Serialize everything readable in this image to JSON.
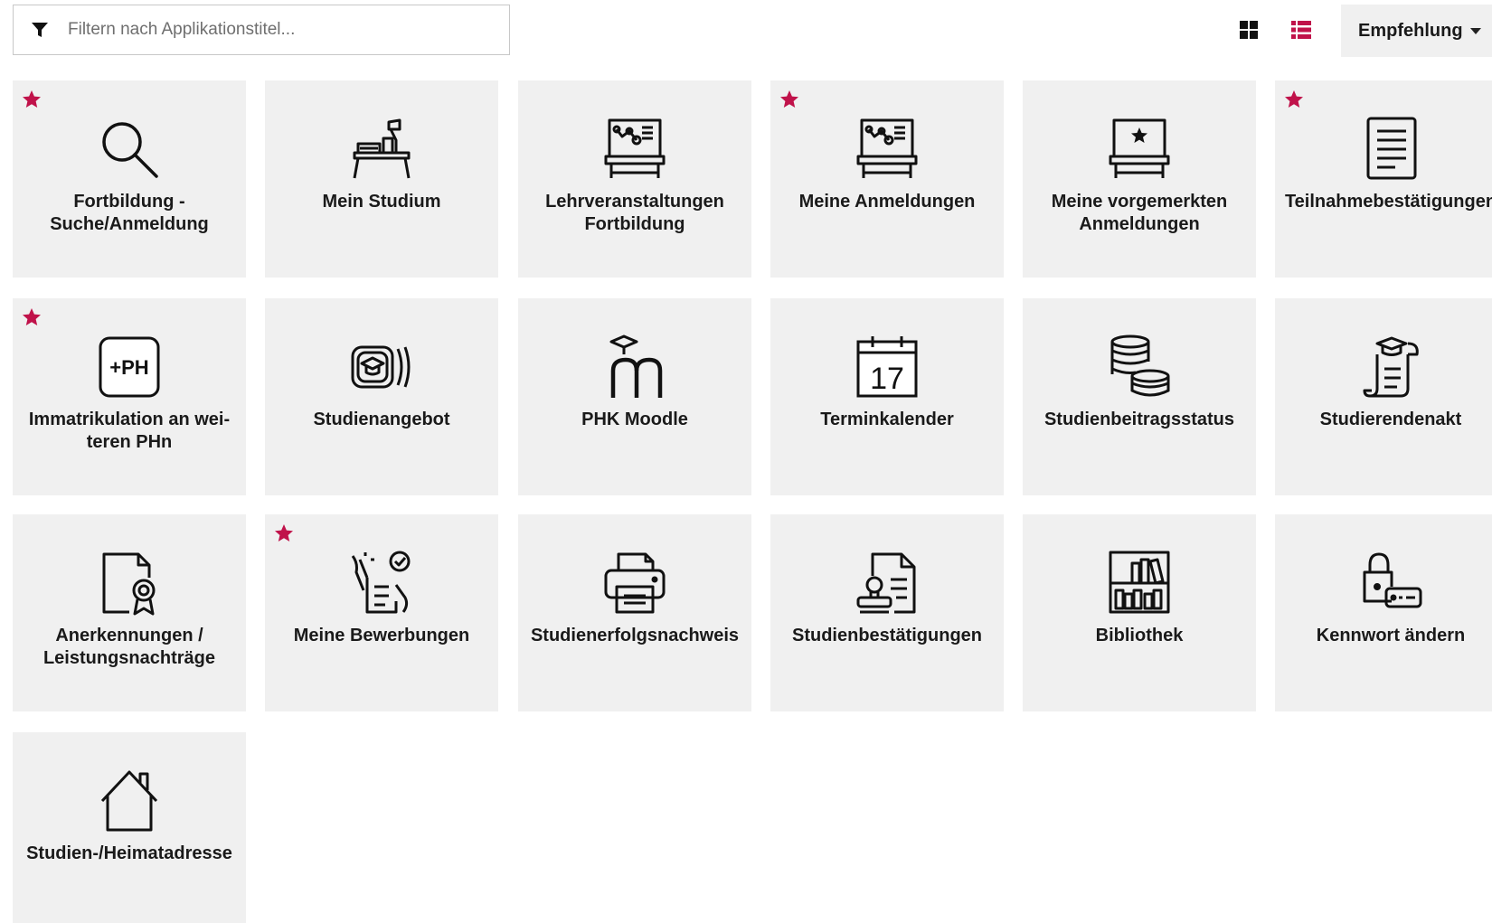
{
  "toolbar": {
    "filter_placeholder": "Filtern nach Applikationstitel...",
    "filter_value": "",
    "sort_label": "Empfehlung",
    "accent_color": "#c0124a"
  },
  "tiles": [
    {
      "label": "Fortbildung - Suche/Anmeldung",
      "favorite": true,
      "icon": "magnifier-icon"
    },
    {
      "label": "Mein Studium",
      "favorite": false,
      "icon": "study-desk-icon"
    },
    {
      "label": "Lehrveranstaltungen Fortbildung",
      "favorite": false,
      "icon": "lecture-board-icon"
    },
    {
      "label": "Meine Anmeldungen",
      "favorite": true,
      "icon": "lecture-board-icon"
    },
    {
      "label": "Meine vorgemerkten Anmeldungen",
      "favorite": false,
      "icon": "starred-board-icon"
    },
    {
      "label": "Teilnahmebestätigun­gen",
      "favorite": true,
      "icon": "document-icon"
    },
    {
      "label": "Immatrikulation an wei­teren PHn",
      "favorite": true,
      "icon": "plus-ph-icon"
    },
    {
      "label": "Studienangebot",
      "favorite": false,
      "icon": "course-offer-icon"
    },
    {
      "label": "PHK Moodle",
      "favorite": false,
      "icon": "moodle-icon"
    },
    {
      "label": "Terminkalender",
      "favorite": false,
      "icon": "calendar-icon"
    },
    {
      "label": "Studienbeitragsstatus",
      "favorite": false,
      "icon": "coins-icon"
    },
    {
      "label": "Studierendenakt",
      "favorite": false,
      "icon": "student-file-icon"
    },
    {
      "label": "Anerkennungen / Leistungsnachträge",
      "favorite": false,
      "icon": "certificate-icon"
    },
    {
      "label": "Meine Bewerbungen",
      "favorite": true,
      "icon": "application-icon"
    },
    {
      "label": "Studienerfolgsnachweis",
      "favorite": false,
      "icon": "printer-icon"
    },
    {
      "label": "Studienbestätigungen",
      "favorite": false,
      "icon": "stamp-document-icon"
    },
    {
      "label": "Bibliothek",
      "favorite": false,
      "icon": "library-icon"
    },
    {
      "label": "Kennwort ändern",
      "favorite": false,
      "icon": "password-lock-icon"
    },
    {
      "label": "Studien-/Heimatadresse",
      "favorite": false,
      "icon": "house-icon"
    }
  ],
  "calendar_day": "17",
  "plus_ph_text": "+PH"
}
